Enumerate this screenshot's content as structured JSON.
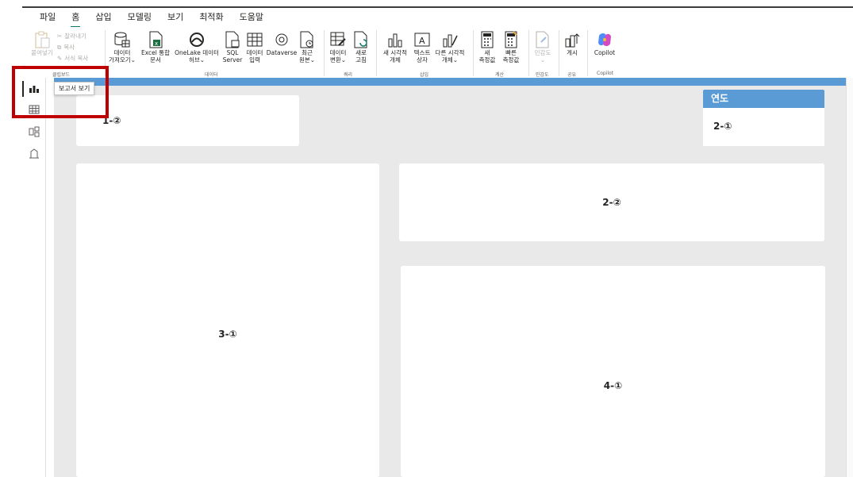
{
  "menu": {
    "tabs": [
      {
        "label": "파일"
      },
      {
        "label": "홈"
      },
      {
        "label": "삽입"
      },
      {
        "label": "모델링"
      },
      {
        "label": "보기"
      },
      {
        "label": "최적화"
      },
      {
        "label": "도움말"
      }
    ],
    "active_tab": "홈"
  },
  "ribbon": {
    "clipboard": {
      "paste": "붙여넣기",
      "cut": "잘라내기",
      "copy": "복사",
      "format_painter": "서식 복사",
      "group": "클립보드"
    },
    "data": {
      "get_data_l1": "데이터",
      "get_data_l2": "가져오기⌄",
      "excel_l1": "Excel 통합",
      "excel_l2": "문서",
      "onelake_l1": "OneLake 데이터",
      "onelake_l2": "허브⌄",
      "sql_l1": "SQL",
      "sql_l2": "Server",
      "enter_l1": "데이터",
      "enter_l2": "입력",
      "dataverse": "Dataverse",
      "recent_l1": "최근",
      "recent_l2": "원본⌄",
      "group": "데이터"
    },
    "query": {
      "transform_l1": "데이터",
      "transform_l2": "변환⌄",
      "refresh_l1": "새로",
      "refresh_l2": "고침",
      "group": "쿼리"
    },
    "insert": {
      "visual_l1": "새 시각적",
      "visual_l2": "개체",
      "textbox_l1": "텍스트",
      "textbox_l2": "상자",
      "more_l1": "다른 시각적",
      "more_l2": "개체⌄",
      "group": "삽입"
    },
    "calc": {
      "new_l1": "새",
      "new_l2": "측정값",
      "quick_l1": "빠른",
      "quick_l2": "측정값",
      "group": "계산"
    },
    "sensitivity": {
      "label": "민감도",
      "arrow": "⌄",
      "group": "민감도"
    },
    "share": {
      "publish": "게시",
      "group": "공유"
    },
    "copilot": {
      "label": "Copilot",
      "group": "Copilot"
    }
  },
  "rail": {
    "tooltip": "보고서 보기"
  },
  "canvas": {
    "card_1_2": "1-②",
    "slicer_title": "연도",
    "slicer_value": "2-①",
    "card_2_2": "2-②",
    "card_3_1": "3-①",
    "card_4_1": "4-①"
  },
  "colors": {
    "accent": "#5b9bd5",
    "tab_underline": "#117865",
    "highlight": "#c00000",
    "canvas_bg": "#e9e9e9"
  }
}
